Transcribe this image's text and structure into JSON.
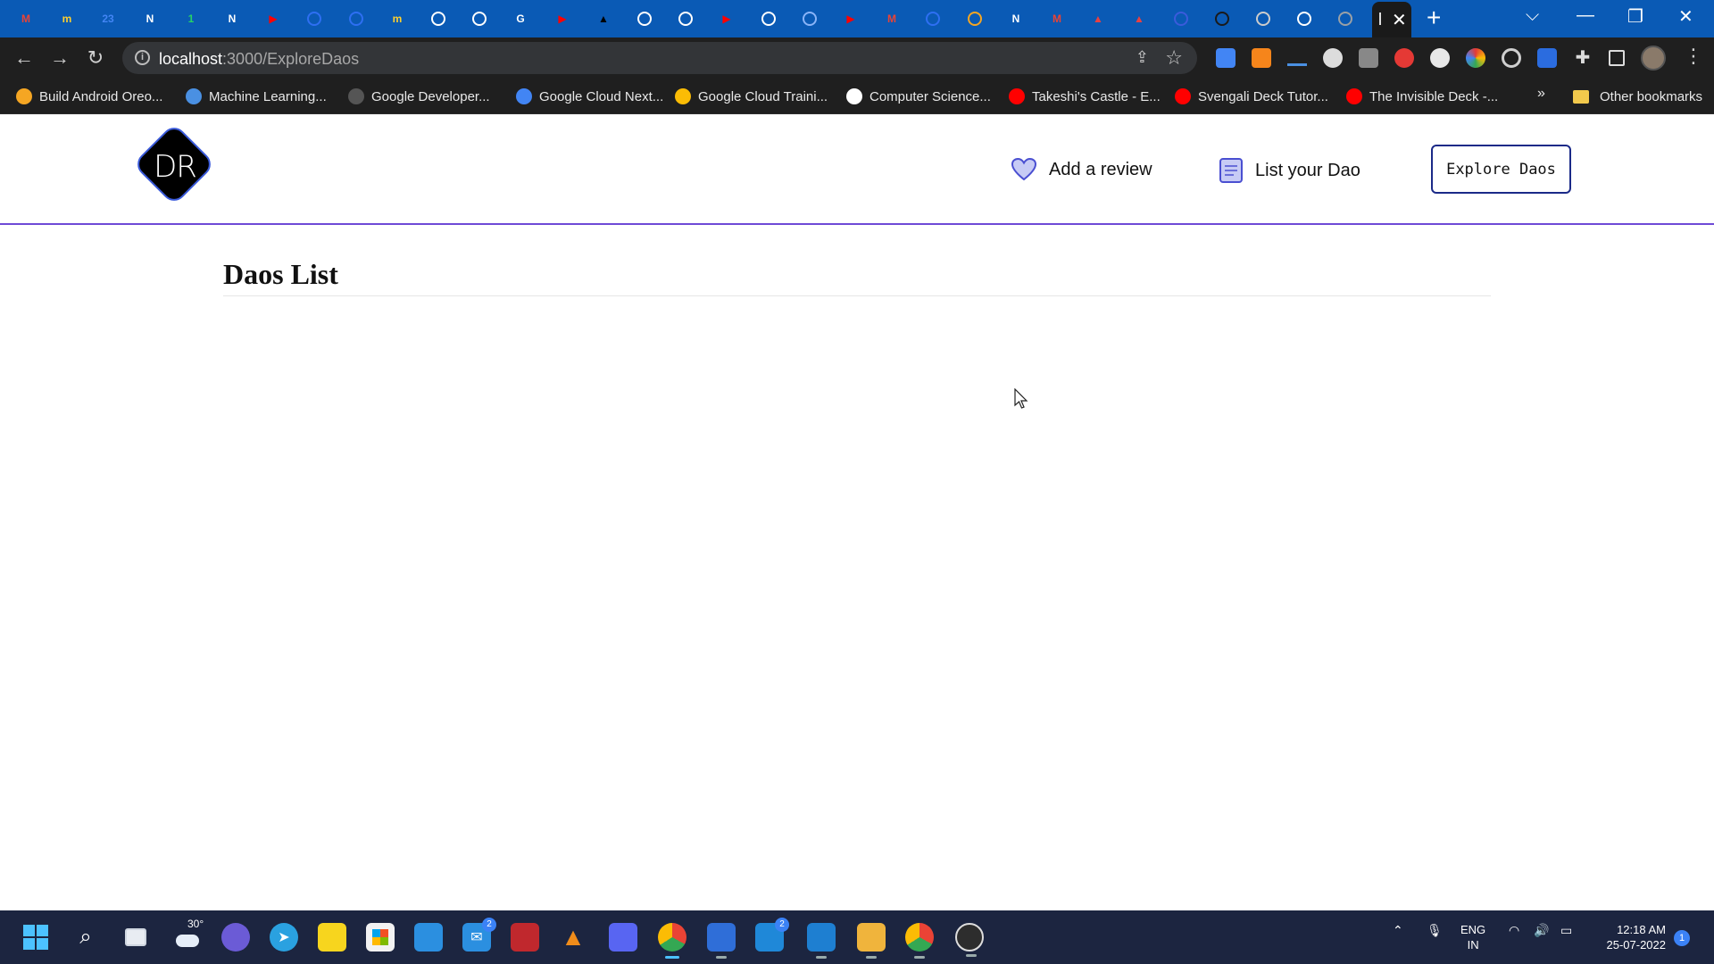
{
  "browser": {
    "tabs": [
      {
        "icon": "gmail-icon",
        "color": "#ea4335",
        "glyph": "M"
      },
      {
        "icon": "miro-icon",
        "color": "#ffd02f",
        "glyph": "m"
      },
      {
        "icon": "calendar-icon",
        "color": "#4285f4",
        "glyph": "23"
      },
      {
        "icon": "notion-icon",
        "color": "#ffffff",
        "glyph": "N"
      },
      {
        "icon": "whatsapp-icon",
        "color": "#25d366",
        "glyph": "1"
      },
      {
        "icon": "notion-icon",
        "color": "#ffffff",
        "glyph": "N"
      },
      {
        "icon": "youtube-icon",
        "color": "#ff0000",
        "glyph": "▶"
      },
      {
        "icon": "tab-icon",
        "color": "#2e6ff2",
        "glyph": ""
      },
      {
        "icon": "tab-icon",
        "color": "#2e6ff2",
        "glyph": ""
      },
      {
        "icon": "miro-icon",
        "color": "#ffd02f",
        "glyph": "m"
      },
      {
        "icon": "github-icon",
        "color": "#ffffff",
        "glyph": ""
      },
      {
        "icon": "github-icon",
        "color": "#ffffff",
        "glyph": ""
      },
      {
        "icon": "google-icon",
        "color": "#ffffff",
        "glyph": "G"
      },
      {
        "icon": "youtube-icon",
        "color": "#ff0000",
        "glyph": "▶"
      },
      {
        "icon": "tab-icon",
        "color": "#000000",
        "glyph": "▲"
      },
      {
        "icon": "openai-icon",
        "color": "#ffffff",
        "glyph": ""
      },
      {
        "icon": "tab-icon",
        "color": "#ffffff",
        "glyph": ""
      },
      {
        "icon": "youtube-icon",
        "color": "#ff0000",
        "glyph": "▶"
      },
      {
        "icon": "openai-icon",
        "color": "#ffffff",
        "glyph": ""
      },
      {
        "icon": "tab-icon",
        "color": "#8ab4f8",
        "glyph": ""
      },
      {
        "icon": "youtube-icon",
        "color": "#ff0000",
        "glyph": "▶"
      },
      {
        "icon": "gmail-icon",
        "color": "#ea4335",
        "glyph": "M"
      },
      {
        "icon": "tab-icon",
        "color": "#2e6ff2",
        "glyph": ""
      },
      {
        "icon": "tab-icon",
        "color": "#f5a623",
        "glyph": ""
      },
      {
        "icon": "notion-icon",
        "color": "#ffffff",
        "glyph": "N"
      },
      {
        "icon": "gmail-icon",
        "color": "#ea4335",
        "glyph": "M"
      },
      {
        "icon": "tab-icon",
        "color": "#e84142",
        "glyph": "▲"
      },
      {
        "icon": "tab-icon",
        "color": "#e84142",
        "glyph": "▲"
      },
      {
        "icon": "tab-icon",
        "color": "#3b5bdb",
        "glyph": ""
      },
      {
        "icon": "tab-icon",
        "color": "#1a1a1a",
        "glyph": ""
      },
      {
        "icon": "tab-icon",
        "color": "#cccccc",
        "glyph": ""
      },
      {
        "icon": "github-icon",
        "color": "#ffffff",
        "glyph": ""
      },
      {
        "icon": "link-icon",
        "color": "#9aa0a6",
        "glyph": ""
      }
    ],
    "active_tab_close": "✕",
    "new_tab": "+",
    "window_controls": {
      "dropdown": "⌵",
      "minimize": "—",
      "restore": "❐",
      "close": "✕"
    },
    "nav": {
      "back": "←",
      "forward": "→",
      "reload": "↻"
    },
    "url_host": "localhost",
    "url_path": ":3000/ExploreDaos",
    "bookmarks": [
      {
        "label": "Build Android Oreo...",
        "color": "#f5a623"
      },
      {
        "label": "Machine Learning...",
        "color": "#4a90e2"
      },
      {
        "label": "Google Developer...",
        "color": "#555555"
      },
      {
        "label": "Google Cloud Next...",
        "color": "#4285f4"
      },
      {
        "label": "Google Cloud Traini...",
        "color": "#fbbc05"
      },
      {
        "label": "Computer Science...",
        "color": "#ffffff"
      },
      {
        "label": "Takeshi's Castle - E...",
        "color": "#ff0000"
      },
      {
        "label": "Svengali Deck Tutor...",
        "color": "#ff0000"
      },
      {
        "label": "The Invisible Deck -...",
        "color": "#ff0000"
      }
    ],
    "bookmarks_more": "»",
    "other_bookmarks": "Other bookmarks"
  },
  "site": {
    "logo_text": "DR",
    "nav": {
      "add_review": "Add a review",
      "list_dao": "List your Dao",
      "explore": "Explore Daos"
    },
    "title": "Daos List"
  },
  "taskbar": {
    "weather": "30°",
    "mail_badge": "2",
    "app_badge": "2",
    "lang_line1": "ENG",
    "lang_line2": "IN",
    "time": "12:18 AM",
    "date": "25-07-2022",
    "notifications": "1"
  },
  "colors": {
    "chrome_tabstrip": "#0a5ab5",
    "chrome_toolbar": "#1f1f1f",
    "header_rule": "#6e4ad6",
    "cta_border": "#1b2a88",
    "taskbar": "#1c2540"
  }
}
